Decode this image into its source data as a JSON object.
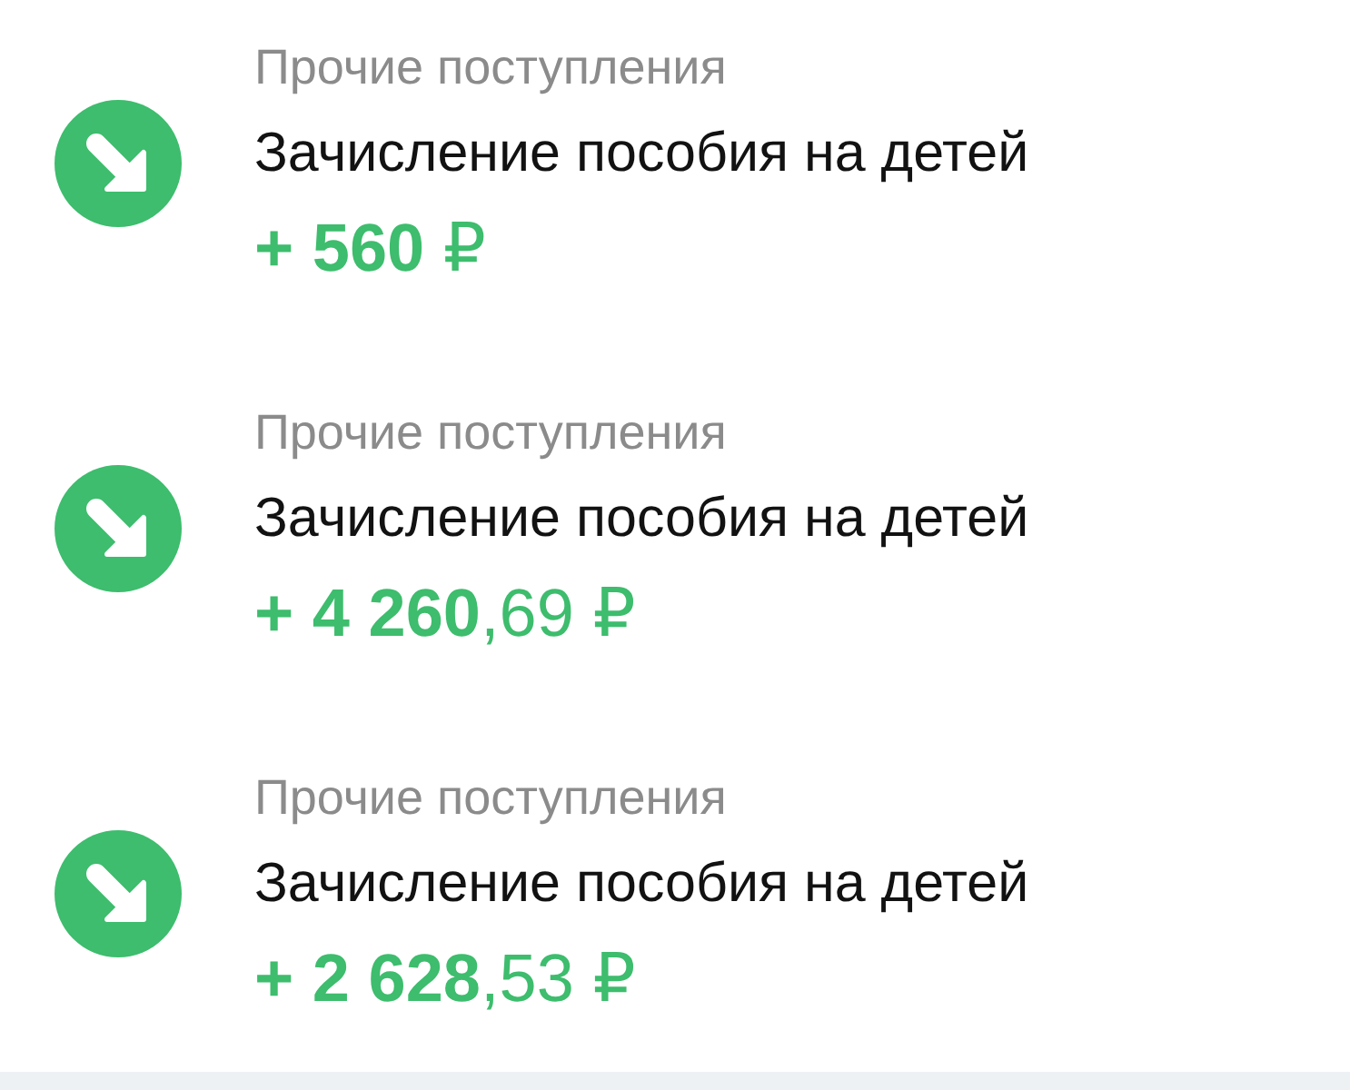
{
  "transactions": [
    {
      "category": "Прочие поступления",
      "title": "Зачисление пособия на детей",
      "amount": "**+ 560** ₽"
    },
    {
      "category": "Прочие поступления",
      "title": "Зачисление пособия на детей",
      "amount": "**+ 4 260**,69 ₽"
    },
    {
      "category": "Прочие поступления",
      "title": "Зачисление пособия на детей",
      "amount": "**+ 2 628**,53 ₽"
    }
  ]
}
